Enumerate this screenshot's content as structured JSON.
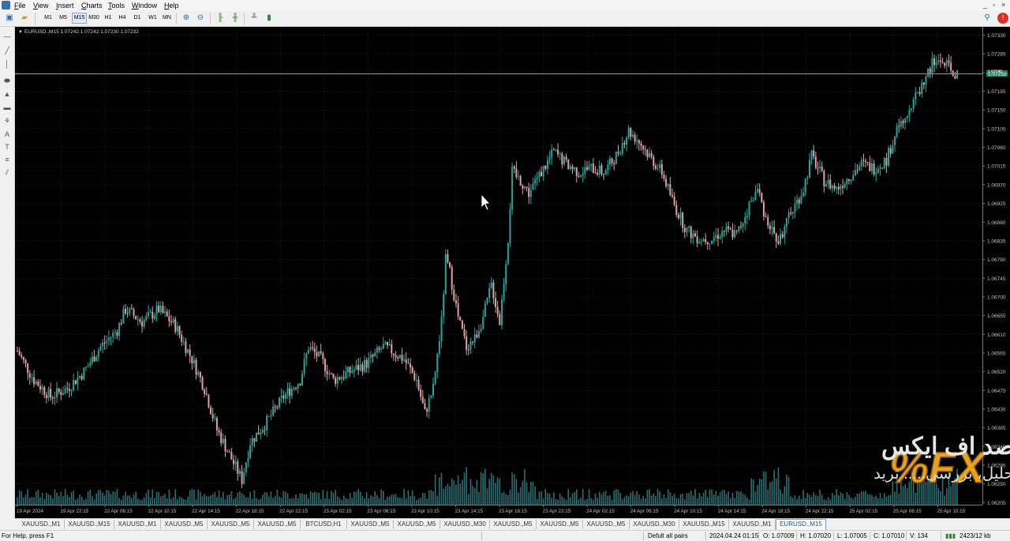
{
  "menubar": {
    "items": [
      {
        "label": "File",
        "key": "F",
        "rest": "ile"
      },
      {
        "label": "View",
        "key": "V",
        "rest": "iew"
      },
      {
        "label": "Insert",
        "key": "I",
        "rest": "nsert"
      },
      {
        "label": "Charts",
        "key": "C",
        "rest": "harts"
      },
      {
        "label": "Tools",
        "key": "T",
        "rest": "ools"
      },
      {
        "label": "Window",
        "key": "W",
        "rest": "indow"
      },
      {
        "label": "Help",
        "key": "H",
        "rest": "elp"
      }
    ]
  },
  "toolbar": {
    "timeframes": [
      "M1",
      "M5",
      "M15",
      "M30",
      "H1",
      "H4",
      "D1",
      "W1",
      "MN"
    ],
    "active_timeframe": "M15"
  },
  "chart": {
    "header": "EURUSD.,M15  1.07242 1.07242 1.07230 1.07232",
    "bid_line": "1.07240",
    "bid_label": "1.07240",
    "ask_label": "1.07232",
    "cursor": "arrow-cursor"
  },
  "chart_data": {
    "type": "candlestick",
    "symbol": "EURUSD.",
    "timeframe": "M15",
    "ylim": [
      1.062,
      1.0735
    ],
    "y_ticks": [
      "1.07330",
      "1.07285",
      "1.07240",
      "1.07195",
      "1.07150",
      "1.07105",
      "1.07060",
      "1.07015",
      "1.06970",
      "1.06925",
      "1.06880",
      "1.06835",
      "1.06790",
      "1.06745",
      "1.06700",
      "1.06655",
      "1.06610",
      "1.06565",
      "1.06520",
      "1.06475",
      "1.06430",
      "1.06385",
      "1.06340",
      "1.06295",
      "1.06250",
      "1.06205"
    ],
    "x_ticks": [
      "19 Apr 2024",
      "19 Apr 22:15",
      "22 Apr 06:15",
      "22 Apr 10:15",
      "22 Apr 14:15",
      "22 Apr 18:15",
      "22 Apr 22:15",
      "23 Apr 02:15",
      "23 Apr 06:15",
      "23 Apr 10:15",
      "23 Apr 14:15",
      "23 Apr 18:15",
      "23 Apr 22:15",
      "24 Apr 02:15",
      "24 Apr 06:15",
      "24 Apr 10:15",
      "24 Apr 14:15",
      "24 Apr 18:15",
      "24 Apr 22:15",
      "25 Apr 02:15",
      "25 Apr 06:15",
      "25 Apr 10:15"
    ],
    "close_path": [
      [
        0,
        1.0657
      ],
      [
        4,
        1.065
      ],
      [
        8,
        1.0646
      ],
      [
        12,
        1.0648
      ],
      [
        16,
        1.0652
      ],
      [
        20,
        1.0658
      ],
      [
        24,
        1.0662
      ],
      [
        26,
        1.0667
      ],
      [
        30,
        1.0664
      ],
      [
        34,
        1.0667
      ],
      [
        38,
        1.0663
      ],
      [
        42,
        1.0655
      ],
      [
        45,
        1.0648
      ],
      [
        48,
        1.0638
      ],
      [
        52,
        1.063
      ],
      [
        54,
        1.0626
      ],
      [
        56,
        1.0635
      ],
      [
        60,
        1.064
      ],
      [
        64,
        1.0646
      ],
      [
        68,
        1.065
      ],
      [
        70,
        1.0658
      ],
      [
        73,
        1.0655
      ],
      [
        76,
        1.065
      ],
      [
        80,
        1.0652
      ],
      [
        84,
        1.0654
      ],
      [
        88,
        1.0658
      ],
      [
        90,
        1.0657
      ],
      [
        93,
        1.0655
      ],
      [
        96,
        1.065
      ],
      [
        98,
        1.0642
      ],
      [
        100,
        1.0648
      ],
      [
        102,
        1.0664
      ],
      [
        103,
        1.0679
      ],
      [
        104,
        1.0676
      ],
      [
        106,
        1.0665
      ],
      [
        108,
        1.0658
      ],
      [
        110,
        1.066
      ],
      [
        112,
        1.0665
      ],
      [
        114,
        1.0673
      ],
      [
        116,
        1.0664
      ],
      [
        118,
        1.0684
      ],
      [
        119,
        1.07
      ],
      [
        121,
        1.0698
      ],
      [
        123,
        1.0695
      ],
      [
        126,
        1.07
      ],
      [
        129,
        1.0705
      ],
      [
        132,
        1.0702
      ],
      [
        135,
        1.07
      ],
      [
        138,
        1.0701
      ],
      [
        141,
        1.07
      ],
      [
        144,
        1.0704
      ],
      [
        147,
        1.071
      ],
      [
        149,
        1.0708
      ],
      [
        152,
        1.0704
      ],
      [
        155,
        1.07
      ],
      [
        158,
        1.0692
      ],
      [
        161,
        1.0686
      ],
      [
        164,
        1.0684
      ],
      [
        167,
        1.0684
      ],
      [
        170,
        1.0686
      ],
      [
        173,
        1.0685
      ],
      [
        176,
        1.0692
      ],
      [
        178,
        1.0696
      ],
      [
        180,
        1.0689
      ],
      [
        183,
        1.0683
      ],
      [
        186,
        1.069
      ],
      [
        189,
        1.0696
      ],
      [
        191,
        1.0704
      ],
      [
        194,
        1.0698
      ],
      [
        197,
        1.0696
      ],
      [
        200,
        1.0699
      ],
      [
        203,
        1.0702
      ],
      [
        206,
        1.0701
      ],
      [
        209,
        1.0703
      ],
      [
        212,
        1.0712
      ],
      [
        215,
        1.0716
      ],
      [
        218,
        1.0722
      ],
      [
        220,
        1.0726
      ],
      [
        222,
        1.0727
      ],
      [
        224,
        1.0725
      ],
      [
        226,
        1.0723
      ]
    ],
    "volume_series": "volume histogram"
  },
  "tabs": {
    "items": [
      "XAUUSD.,M1",
      "XAUUSD.,M15",
      "XAUUSD.,M1",
      "XAUUSD.,M5",
      "XAUUSD.,M5",
      "XAUUSD.,M5",
      "BTCUSD,H1",
      "XAUUSD.,M5",
      "XAUUSD.,M5",
      "XAUUSD.,M30",
      "XAUUSD.,M5",
      "XAUUSD.,M5",
      "XAUUSD.,M5",
      "XAUUSD.,M30",
      "XAUUSD.,M15",
      "XAUUSD.,M1",
      "EURUSD.,M15"
    ],
    "active_index": 16
  },
  "statusbar": {
    "help": "For Help, press F1",
    "profile": "Defult all pairs",
    "datetime": "2024.04.24 01:15",
    "open": "O: 1.07009",
    "high": "H: 1.07020",
    "low": "L: 1.07005",
    "close": "C: 1.07010",
    "volume": "V: 134",
    "traffic": "2423/12 kb"
  },
  "watermark": {
    "logo_text": "%FX",
    "title_fa": "درصد اف ایکس",
    "subtitle_fa": "تحلیل، بررسی..... ترید",
    "accent": "#e8a319",
    "text_color": "#e6e6e6"
  },
  "colors": {
    "bull": "#26a69a",
    "bear": "#e0a2a2",
    "grid": "#2a3a3a",
    "bid_line": "#c8894a",
    "axis_text": "#c0c0c0",
    "volume": "#2b6f74"
  }
}
